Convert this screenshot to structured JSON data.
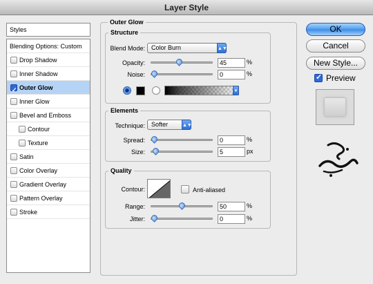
{
  "window": {
    "title": "Layer Style"
  },
  "sidebar": {
    "header": "Styles",
    "items": [
      {
        "label": "Blending Options: Custom",
        "checkbox": false,
        "checked": false,
        "selected": false,
        "sub": false
      },
      {
        "label": "Drop Shadow",
        "checkbox": true,
        "checked": false,
        "selected": false,
        "sub": false
      },
      {
        "label": "Inner Shadow",
        "checkbox": true,
        "checked": false,
        "selected": false,
        "sub": false
      },
      {
        "label": "Outer Glow",
        "checkbox": true,
        "checked": true,
        "selected": true,
        "sub": false
      },
      {
        "label": "Inner Glow",
        "checkbox": true,
        "checked": false,
        "selected": false,
        "sub": false
      },
      {
        "label": "Bevel and Emboss",
        "checkbox": true,
        "checked": false,
        "selected": false,
        "sub": false
      },
      {
        "label": "Contour",
        "checkbox": true,
        "checked": false,
        "selected": false,
        "sub": true
      },
      {
        "label": "Texture",
        "checkbox": true,
        "checked": false,
        "selected": false,
        "sub": true
      },
      {
        "label": "Satin",
        "checkbox": true,
        "checked": false,
        "selected": false,
        "sub": false
      },
      {
        "label": "Color Overlay",
        "checkbox": true,
        "checked": false,
        "selected": false,
        "sub": false
      },
      {
        "label": "Gradient Overlay",
        "checkbox": true,
        "checked": false,
        "selected": false,
        "sub": false
      },
      {
        "label": "Pattern Overlay",
        "checkbox": true,
        "checked": false,
        "selected": false,
        "sub": false
      },
      {
        "label": "Stroke",
        "checkbox": true,
        "checked": false,
        "selected": false,
        "sub": false
      }
    ]
  },
  "panel": {
    "title": "Outer Glow",
    "structure": {
      "title": "Structure",
      "blend_mode_label": "Blend Mode:",
      "blend_mode_value": "Color Burn",
      "opacity_label": "Opacity:",
      "opacity_value": "45",
      "opacity_level": 0.45,
      "opacity_unit": "%",
      "noise_label": "Noise:",
      "noise_value": "0",
      "noise_level": 0,
      "noise_unit": "%",
      "glow_color": "#000000"
    },
    "elements": {
      "title": "Elements",
      "technique_label": "Technique:",
      "technique_value": "Softer",
      "spread_label": "Spread:",
      "spread_value": "0",
      "spread_level": 0,
      "spread_unit": "%",
      "size_label": "Size:",
      "size_value": "5",
      "size_level": 0.02,
      "size_unit": "px"
    },
    "quality": {
      "title": "Quality",
      "contour_label": "Contour:",
      "anti_aliased_label": "Anti-aliased",
      "anti_aliased_checked": false,
      "range_label": "Range:",
      "range_value": "50",
      "range_level": 0.5,
      "range_unit": "%",
      "jitter_label": "Jitter:",
      "jitter_value": "0",
      "jitter_level": 0,
      "jitter_unit": "%"
    }
  },
  "buttons": {
    "ok": "OK",
    "cancel": "Cancel",
    "new_style": "New Style...",
    "preview_label": "Preview",
    "preview_checked": true
  },
  "colors": {
    "accent": "#3b8be6",
    "selected_row": "#b5d3f5"
  }
}
